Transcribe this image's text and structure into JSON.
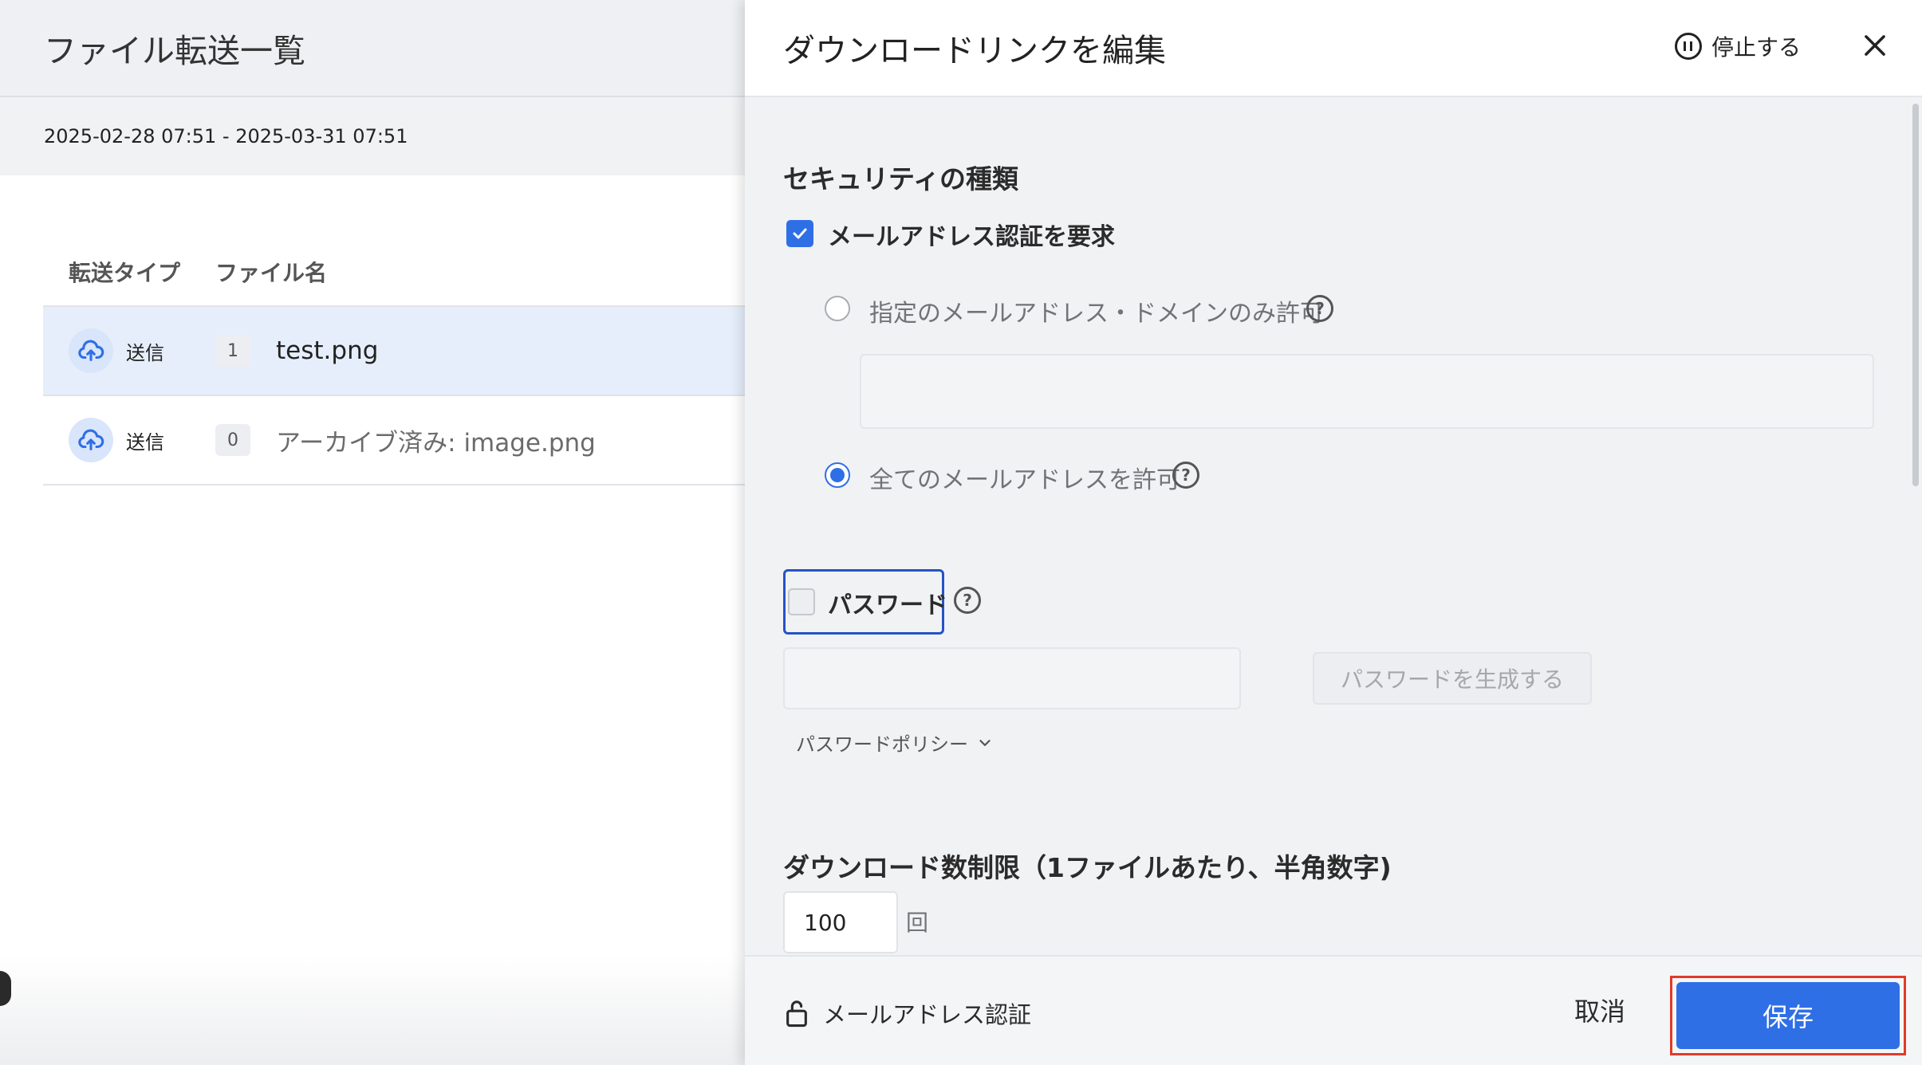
{
  "list_panel": {
    "title": "ファイル転送一覧",
    "date_range": "2025-02-28 07:51 - 2025-03-31 07:51",
    "columns": [
      "転送タイプ",
      "ファイル名"
    ],
    "rows": [
      {
        "type_icon": "cloud-upload-icon",
        "type": "送信",
        "count": "1",
        "file_name": "test.png",
        "selected": true
      },
      {
        "type_icon": "cloud-upload-icon",
        "type": "送信",
        "count": "0",
        "file_name": "アーカイブ済み: image.png",
        "selected": false
      }
    ]
  },
  "drawer": {
    "title": "ダウンロードリンクを編集",
    "pause_label": "停止する",
    "pause_icon": "pause-circle-icon",
    "close_icon": "close-icon",
    "security": {
      "heading": "セキュリティの種類",
      "email_auth": {
        "label": "メールアドレス認証を要求",
        "checked": true
      },
      "options": [
        {
          "label": "指定のメールアドレス・ドメインのみ許可",
          "selected": false
        },
        {
          "label": "全てのメールアドレスを許可",
          "selected": true
        }
      ],
      "domain_input_value": "",
      "password": {
        "label": "パスワード",
        "checked": false,
        "value": "",
        "generate_label": "パスワードを生成する",
        "policy_label": "パスワードポリシー"
      }
    },
    "download_limit": {
      "heading": "ダウンロード数制限（1ファイルあたり、半角数字)",
      "value": "100",
      "unit": "回"
    },
    "footer": {
      "status_icon": "unlock-icon",
      "status_label": "メールアドレス認証",
      "cancel_label": "取消",
      "save_label": "保存"
    }
  },
  "colors": {
    "accent": "#2f6fe6",
    "highlight": "#e03b2b",
    "selected_row": "#e6eefb"
  }
}
